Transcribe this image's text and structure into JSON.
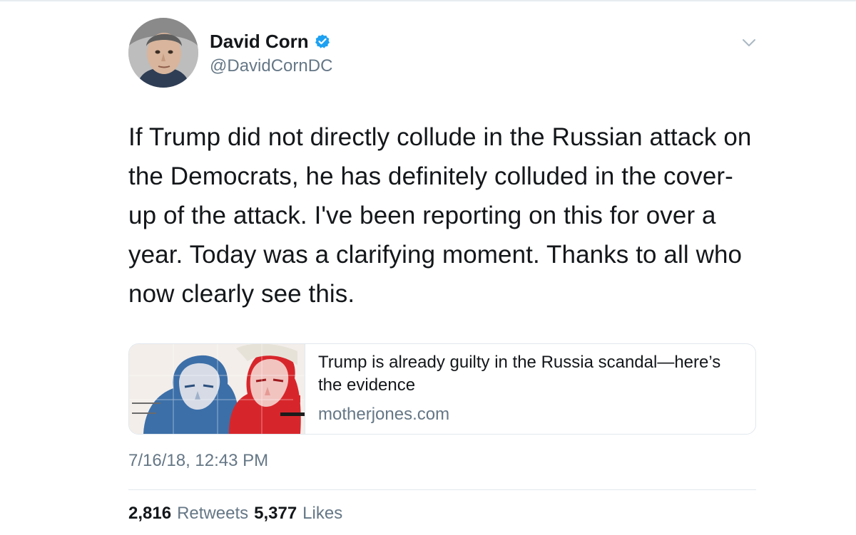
{
  "tweet": {
    "author": {
      "display_name": "David Corn",
      "handle": "@DavidCornDC",
      "verified": true,
      "avatar_icon": "avatar-portrait"
    },
    "menu_icon": "chevron-down-icon",
    "text": "If Trump did not directly collude in the Russian attack on the Democrats, he has definitely colluded in the cover-up of the attack. I've been reporting on this for over a year. Today was a clarifying moment. Thanks to all who now clearly see this.",
    "link_card": {
      "title": "Trump is already guilty in the Russia scandal—here’s the evidence",
      "domain": "motherjones.com",
      "image_icon": "card-thumbnail-image"
    },
    "timestamp": "7/16/18, 12:43 PM",
    "stats": {
      "retweets_count": "2,816",
      "retweets_label": "Retweets",
      "likes_count": "5,377",
      "likes_label": "Likes"
    }
  },
  "colors": {
    "text_primary": "#14171a",
    "text_secondary": "#657786",
    "border": "#e1e8ed",
    "verified_blue": "#1da1f2",
    "card_red": "#d7262b",
    "card_blue": "#3c6fa8"
  }
}
